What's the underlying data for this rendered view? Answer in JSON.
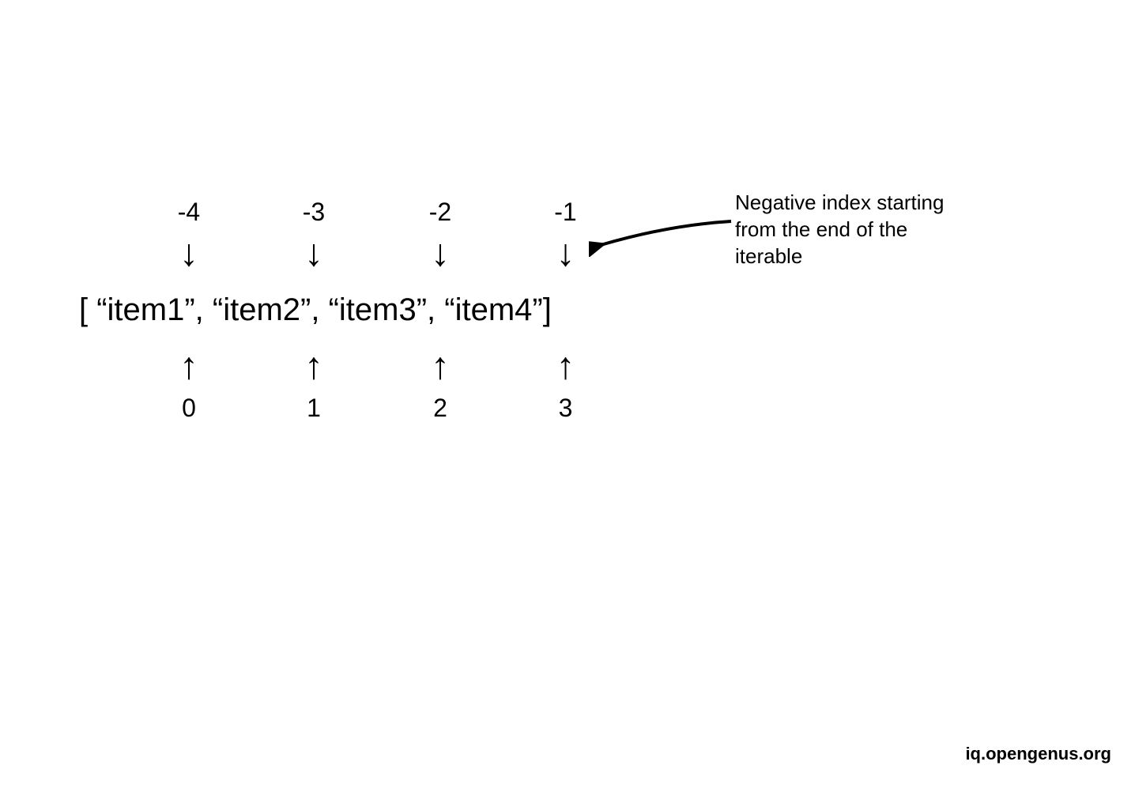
{
  "negative_indices": [
    "-4",
    "-3",
    "-2",
    "-1"
  ],
  "positive_indices": [
    "0",
    "1",
    "2",
    "3"
  ],
  "down_arrow": "↓",
  "up_arrow": "↑",
  "list_display": "[ “item1”, “item2”, “item3”, “item4”]",
  "items": [
    "item1",
    "item2",
    "item3",
    "item4"
  ],
  "callout_line1": "Negative index starting",
  "callout_line2": "from the end of the",
  "callout_line3": "iterable",
  "watermark": "iq.opengenus.org"
}
